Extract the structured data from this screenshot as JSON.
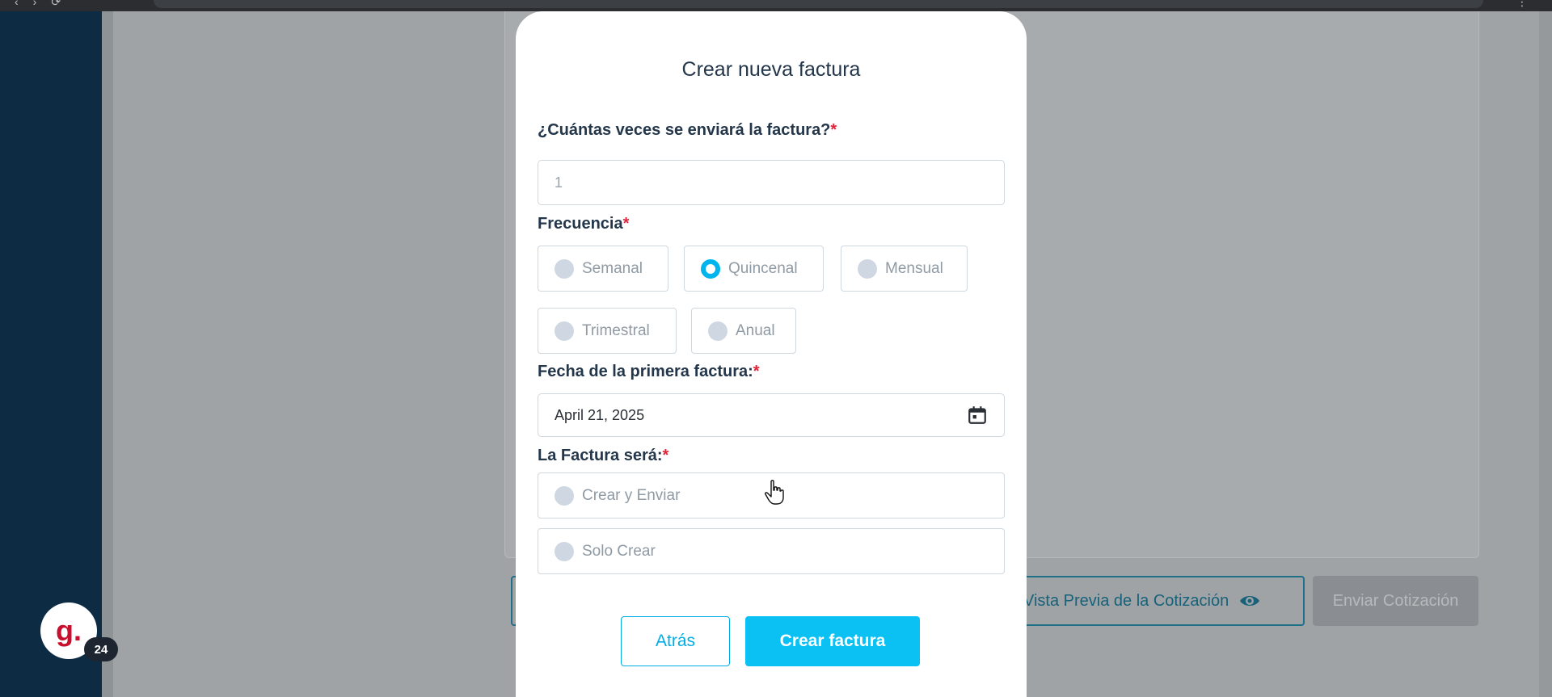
{
  "modal": {
    "title": "Crear nueva factura",
    "times_label": "¿Cuántas veces se enviará la factura?",
    "times_value": "1",
    "frequency_label": "Frecuencia",
    "frequency_options": [
      "Semanal",
      "Quincenal",
      "Mensual",
      "Trimestral",
      "Anual"
    ],
    "frequency_selected": "Quincenal",
    "first_date_label": "Fecha de la primera factura:",
    "first_date_value": "April 21, 2025",
    "mode_label": "La Factura será:",
    "mode_options": [
      "Crear y Enviar",
      "Solo Crear"
    ],
    "required_mark": "*",
    "back_label": "Atrás",
    "create_label": "Crear factura"
  },
  "background_page": {
    "preview_label": "Vista Previa de la Cotización",
    "send_label": "Enviar Cotización"
  },
  "widget": {
    "logo_text": "g.",
    "badge_count": "24"
  },
  "colors": {
    "accent": "#0bc0f2",
    "sidebar": "#0e2b44",
    "required": "#e0243a"
  }
}
